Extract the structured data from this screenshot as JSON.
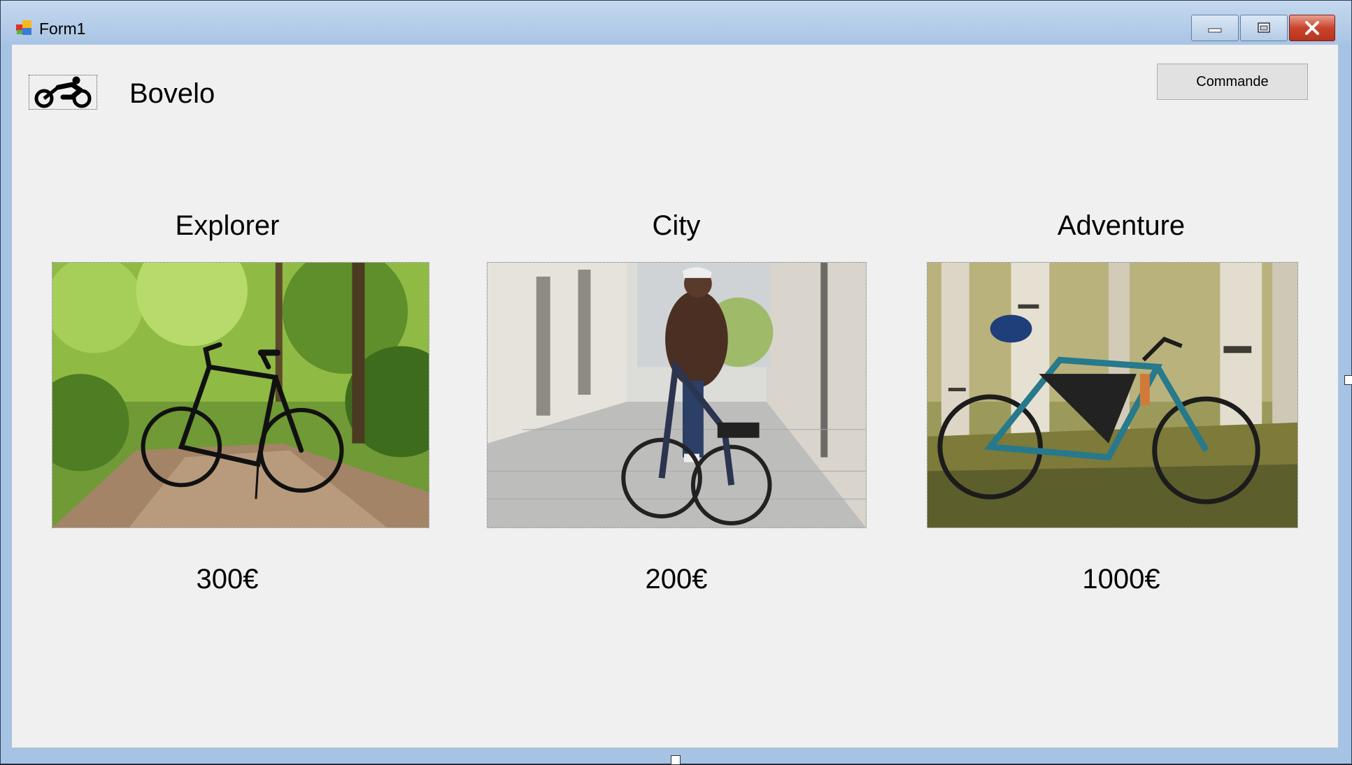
{
  "window": {
    "title": "Form1",
    "controls": {
      "minimize": "minimize",
      "maximize": "maximize",
      "close": "close"
    }
  },
  "header": {
    "brand": "Bovelo",
    "logo_icon": "cyclist-icon",
    "order_button": "Commande"
  },
  "products": [
    {
      "name": "Explorer",
      "price": "300€",
      "image": "hybrid bike on forest path"
    },
    {
      "name": "City",
      "price": "200€",
      "image": "woman riding city e-bike"
    },
    {
      "name": "Adventure",
      "price": "1000€",
      "image": "gravel bike among birch trees"
    }
  ],
  "colors": {
    "client_bg": "#f0f0f0",
    "titlebar": "#a9c4e4",
    "close_button": "#c8442c"
  }
}
